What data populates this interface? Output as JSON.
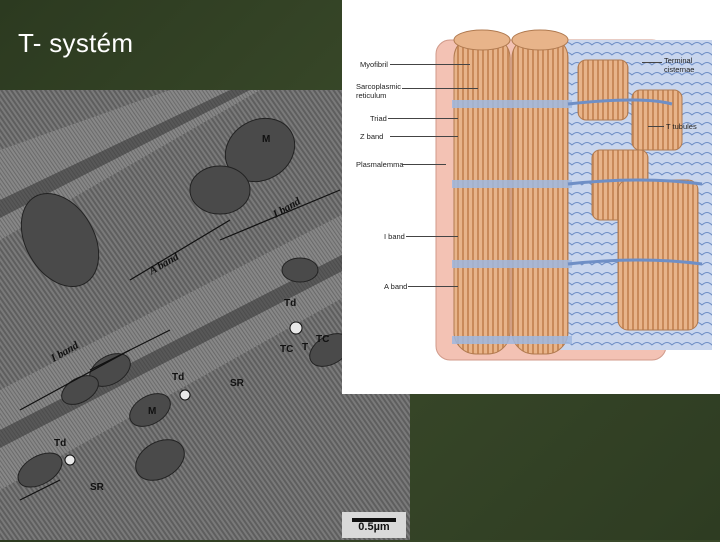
{
  "slide": {
    "title": "T- systém"
  },
  "micrograph": {
    "labels": {
      "m1": "M",
      "m2": "M",
      "iband1": "I band",
      "aband": "A band",
      "iband2": "I band",
      "td1": "Td",
      "td2": "Td",
      "td3": "Td",
      "tc1": "TC",
      "tc2": "TC",
      "t": "T",
      "sr1": "SR",
      "sr2": "SR"
    },
    "scale": "0.5µm"
  },
  "diagram": {
    "left_labels": {
      "myofibril": "Myofibril",
      "sr": "Sarcoplasmic reticulum",
      "triad": "Triad",
      "zband": "Z band",
      "plasmalemma": "Plasmalemma",
      "iband": "I band",
      "aband": "A band"
    },
    "right_labels": {
      "terminal": "Terminal cisternae",
      "ttubules": "T tubules"
    },
    "colors": {
      "myofibril": "#e8b48a",
      "myofibril_stripe": "#c98a5a",
      "reticulum": "#9fb8e0",
      "reticulum_dark": "#6f8fc6",
      "membrane": "#f3c2b4"
    }
  }
}
